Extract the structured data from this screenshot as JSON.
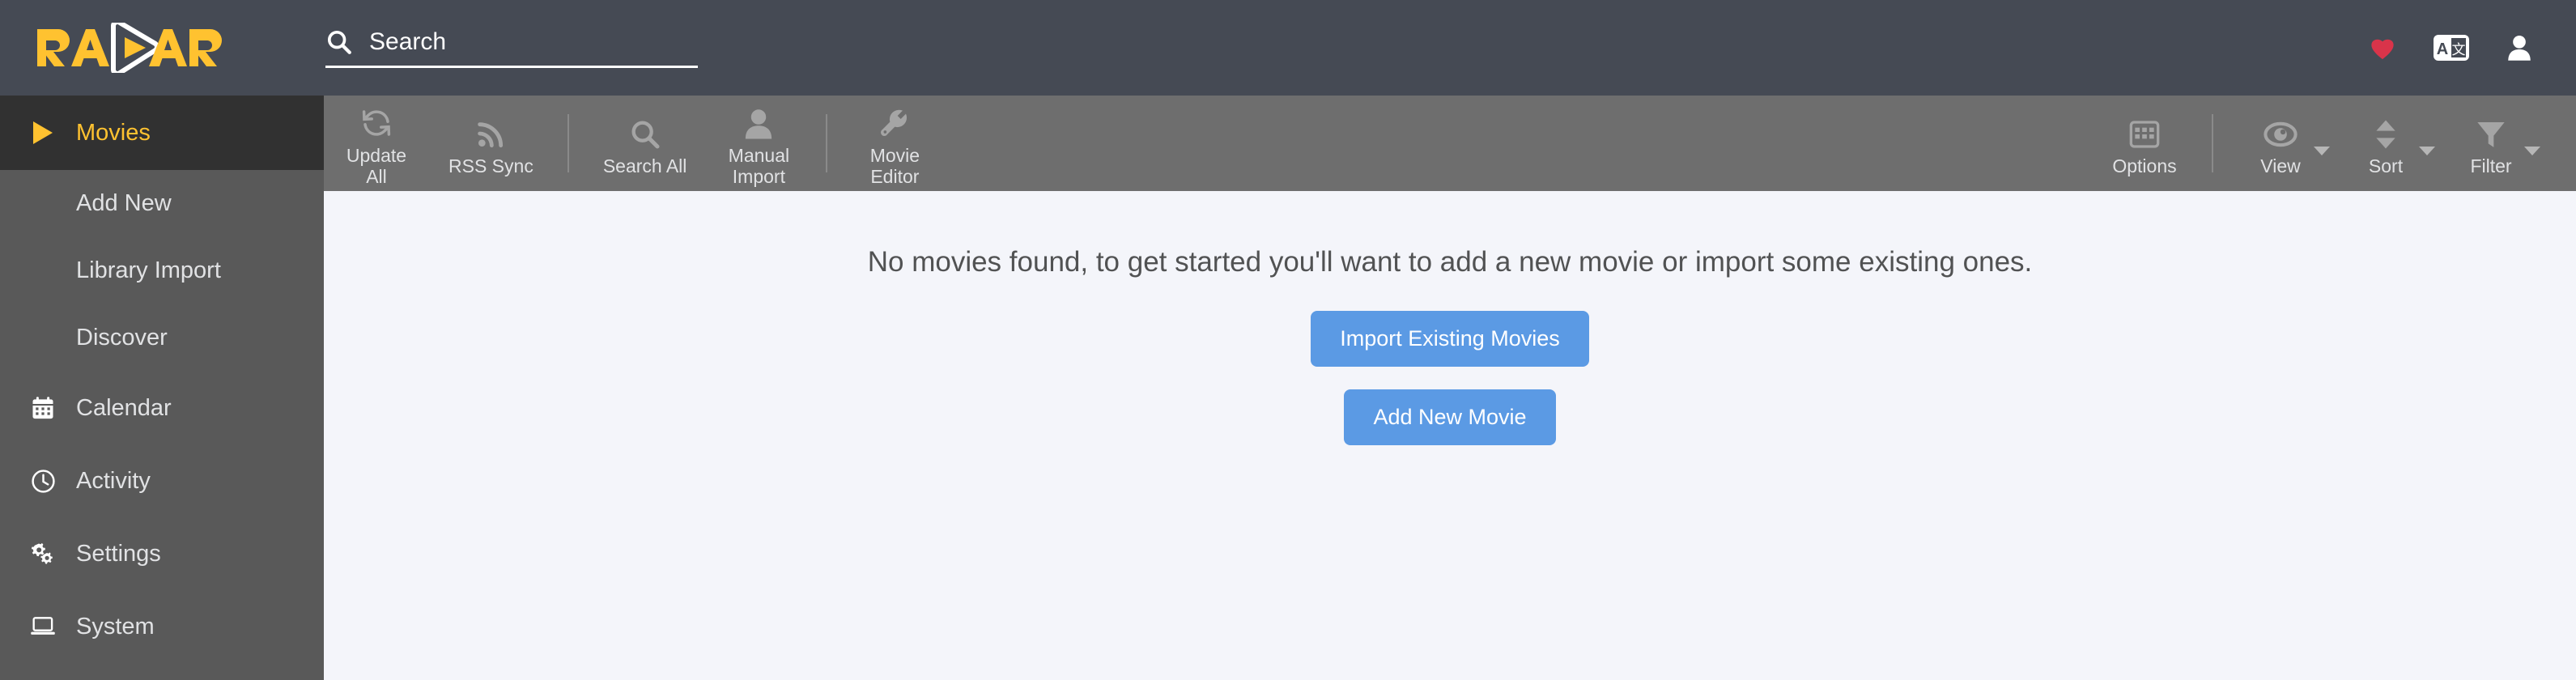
{
  "app": {
    "name": "Radarr",
    "logo_text_left": "RA",
    "logo_text_right": "ARR",
    "accent_yellow": "#ffc230",
    "header_bg": "#454a54",
    "sidebar_bg": "#595959",
    "sidebar_active_bg": "#313131",
    "toolbar_bg": "#6e6e6e",
    "content_bg": "#f4f5fa",
    "button_blue": "#5b9ae4"
  },
  "header": {
    "search": {
      "placeholder": "Search",
      "value": "",
      "icon": "search-icon"
    },
    "actions": [
      {
        "name": "donate-heart-icon",
        "label": "Donate",
        "color": "#d9344a"
      },
      {
        "name": "translate-icon",
        "label": "Translate",
        "glyph_left": "A",
        "glyph_right": "文"
      },
      {
        "name": "user-account-icon",
        "label": "Account"
      }
    ]
  },
  "sidebar": {
    "items": [
      {
        "label": "Movies",
        "icon": "play-triangle-icon",
        "active": true
      },
      {
        "label": "Add New",
        "sub": true
      },
      {
        "label": "Library Import",
        "sub": true
      },
      {
        "label": "Discover",
        "sub": true
      },
      {
        "label": "Calendar",
        "icon": "calendar-icon",
        "active": false
      },
      {
        "label": "Activity",
        "icon": "clock-icon",
        "active": false
      },
      {
        "label": "Settings",
        "icon": "gears-icon",
        "active": false
      },
      {
        "label": "System",
        "icon": "laptop-icon",
        "active": false
      }
    ]
  },
  "toolbar": {
    "left_buttons": [
      {
        "label": "Update\nAll",
        "icon": "refresh-icon"
      },
      {
        "label": "RSS Sync",
        "icon": "rss-icon"
      },
      {
        "label": "Search All",
        "icon": "search-icon"
      },
      {
        "label": "Manual\nImport",
        "icon": "person-icon"
      },
      {
        "label": "Movie\nEditor",
        "icon": "wrench-icon"
      }
    ],
    "right_buttons": [
      {
        "label": "Options",
        "icon": "grid-icon",
        "caret": false
      },
      {
        "label": "View",
        "icon": "eye-icon",
        "caret": true
      },
      {
        "label": "Sort",
        "icon": "sort-arrows-icon",
        "caret": true
      },
      {
        "label": "Filter",
        "icon": "funnel-icon",
        "caret": true
      }
    ]
  },
  "main": {
    "empty_message": "No movies found, to get started you'll want to add a new movie or import some existing ones.",
    "import_button": "Import Existing Movies",
    "add_button": "Add New Movie"
  }
}
